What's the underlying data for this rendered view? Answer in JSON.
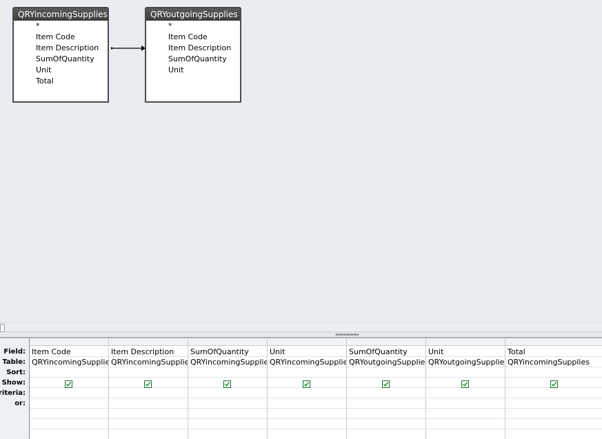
{
  "tables": [
    {
      "title": "QRYincomingSupplies",
      "fields": [
        "*",
        "Item Code",
        "Item Description",
        "SumOfQuantity",
        "Unit",
        "Total"
      ]
    },
    {
      "title": "QRYoutgoingSupplies",
      "fields": [
        "*",
        "Item Code",
        "Item Description",
        "SumOfQuantity",
        "Unit"
      ]
    }
  ],
  "grid": {
    "row_labels": {
      "field": "Field:",
      "table": "Table:",
      "sort": "Sort:",
      "show": "Show:",
      "criteria": "Criteria:",
      "or": "or:"
    },
    "columns": [
      {
        "field": "Item Code",
        "table": "QRYincomingSupplies",
        "show": true
      },
      {
        "field": "Item Description",
        "table": "QRYincomingSupplies",
        "show": true
      },
      {
        "field": "SumOfQuantity",
        "table": "QRYincomingSupplies",
        "show": true
      },
      {
        "field": "Unit",
        "table": "QRYincomingSupplies",
        "show": true
      },
      {
        "field": "SumOfQuantity",
        "table": "QRYoutgoingSupplies",
        "show": true
      },
      {
        "field": "Unit",
        "table": "QRYoutgoingSupplies",
        "show": true
      },
      {
        "field": "Total",
        "table": "QRYincomingSupplies",
        "show": true
      }
    ]
  }
}
